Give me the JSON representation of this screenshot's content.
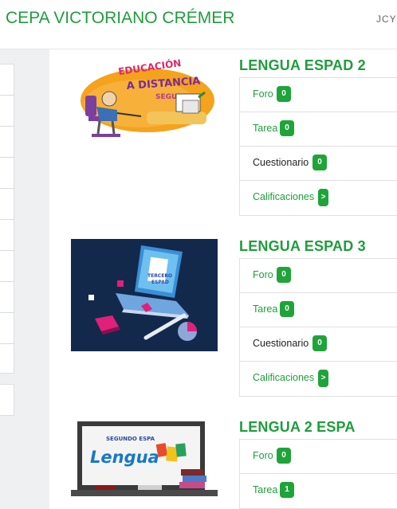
{
  "header": {
    "site_title": "CEPA VICTORIANO CRÉMER",
    "right_text": "JCYL"
  },
  "courses": [
    {
      "title": "LENGUA ESPAD 2",
      "image": {
        "lines": [
          "EDUCACIÓN",
          "A DISTANCIA",
          "SEGUNDO"
        ]
      },
      "activities": [
        {
          "label": "Foro",
          "badge": "0"
        },
        {
          "label": "Tarea",
          "badge": "0"
        },
        {
          "label": "Cuestionario",
          "badge": "0"
        },
        {
          "label": "Calificaciones",
          "badge": ">"
        }
      ]
    },
    {
      "title": "LENGUA ESPAD 3",
      "image": {
        "lines": [
          "TERCERO",
          "ESPAD"
        ]
      },
      "activities": [
        {
          "label": "Foro",
          "badge": "0"
        },
        {
          "label": "Tarea",
          "badge": "0"
        },
        {
          "label": "Cuestionario",
          "badge": "0"
        },
        {
          "label": "Calificaciones",
          "badge": ">"
        }
      ]
    },
    {
      "title": "LENGUA 2 ESPA",
      "image": {
        "lines": [
          "SEGUNDO ESPA",
          "Lengua"
        ]
      },
      "activities": [
        {
          "label": "Foro",
          "badge": "0"
        },
        {
          "label": "Tarea",
          "badge": "1"
        }
      ]
    }
  ],
  "colors": {
    "accent": "#1f9d3c",
    "badge": "#1fa43a"
  }
}
